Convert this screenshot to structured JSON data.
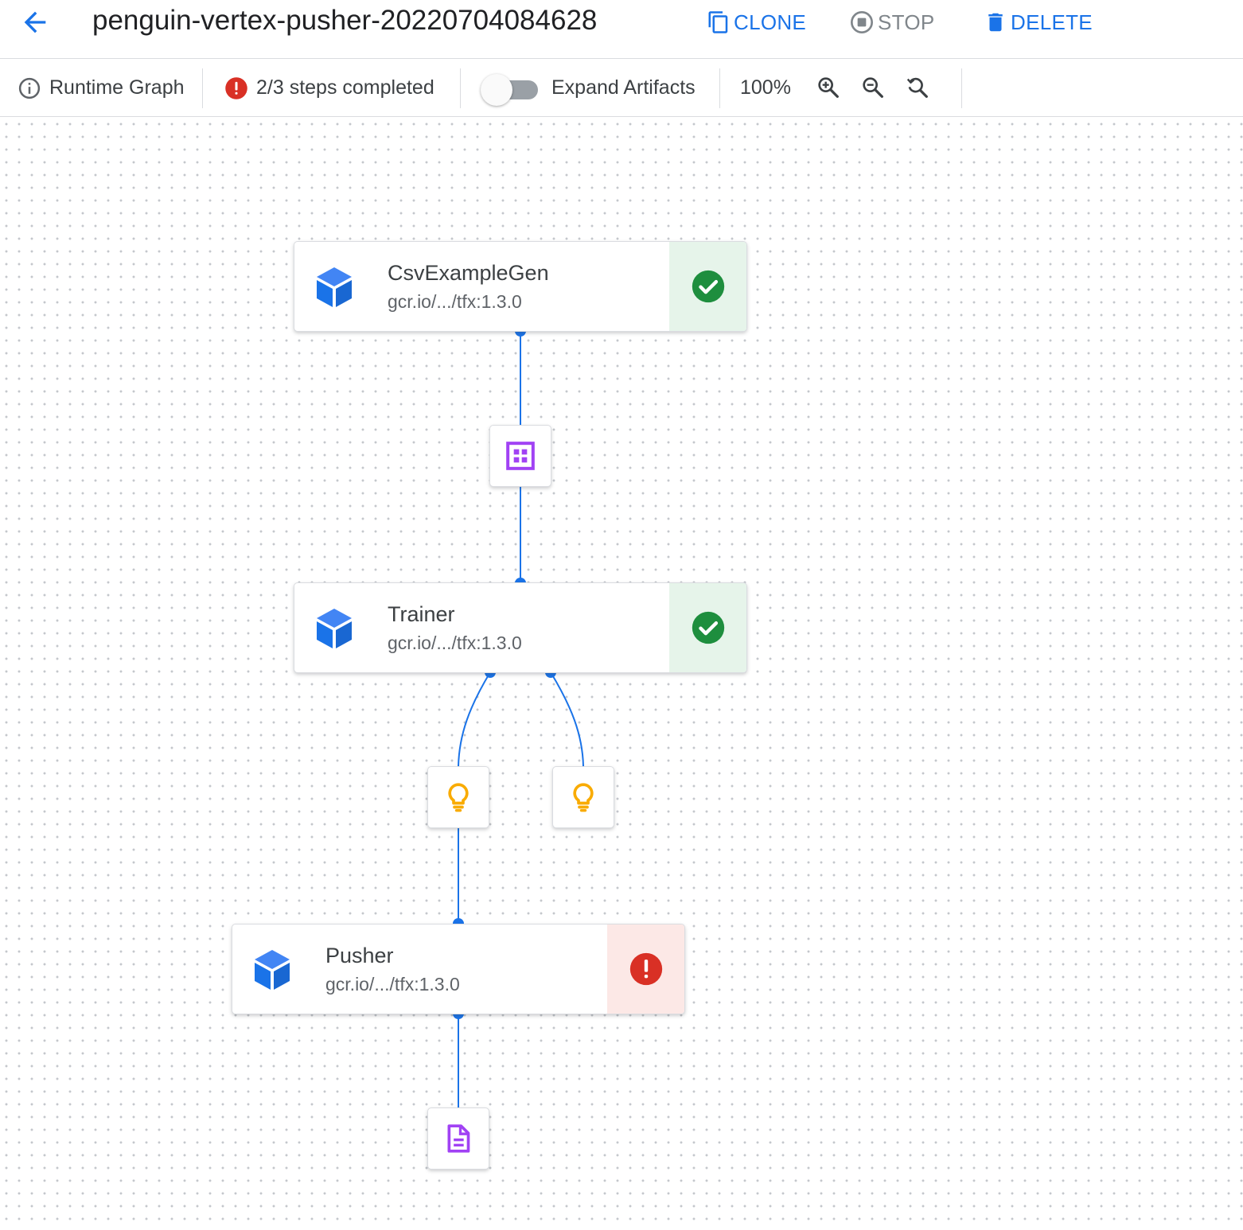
{
  "header": {
    "title": "penguin-vertex-pusher-20220704084628",
    "actions": {
      "clone": "CLONE",
      "stop": "STOP",
      "delete": "DELETE"
    }
  },
  "toolbar": {
    "runtime_graph": "Runtime Graph",
    "steps_status": "2/3 steps completed",
    "expand_artifacts": "Expand Artifacts",
    "expand_artifacts_on": false,
    "zoom_level": "100%"
  },
  "graph": {
    "nodes": [
      {
        "name": "CsvExampleGen",
        "image": "gcr.io/.../tfx:1.3.0",
        "status": "succeeded",
        "icon": "check-circle-icon"
      },
      {
        "name": "Trainer",
        "image": "gcr.io/.../tfx:1.3.0",
        "status": "succeeded",
        "icon": "check-circle-icon"
      },
      {
        "name": "Pusher",
        "image": "gcr.io/.../tfx:1.3.0",
        "status": "failed",
        "icon": "error-icon"
      }
    ],
    "artifacts": [
      {
        "type": "examples",
        "icon": "dataset-grid-icon"
      },
      {
        "type": "model",
        "icon": "lightbulb-icon"
      },
      {
        "type": "model-run",
        "icon": "lightbulb-icon"
      },
      {
        "type": "pushed-model",
        "icon": "document-icon"
      }
    ]
  },
  "colors": {
    "accent": "#1a73e8",
    "edge": "#1a73e8",
    "success": "#1e8e3e",
    "success_bg": "#e6f4ea",
    "error": "#d93025",
    "error_bg": "#fce8e6",
    "artifact_purple": "#a142f4",
    "artifact_yellow": "#f9ab00"
  }
}
